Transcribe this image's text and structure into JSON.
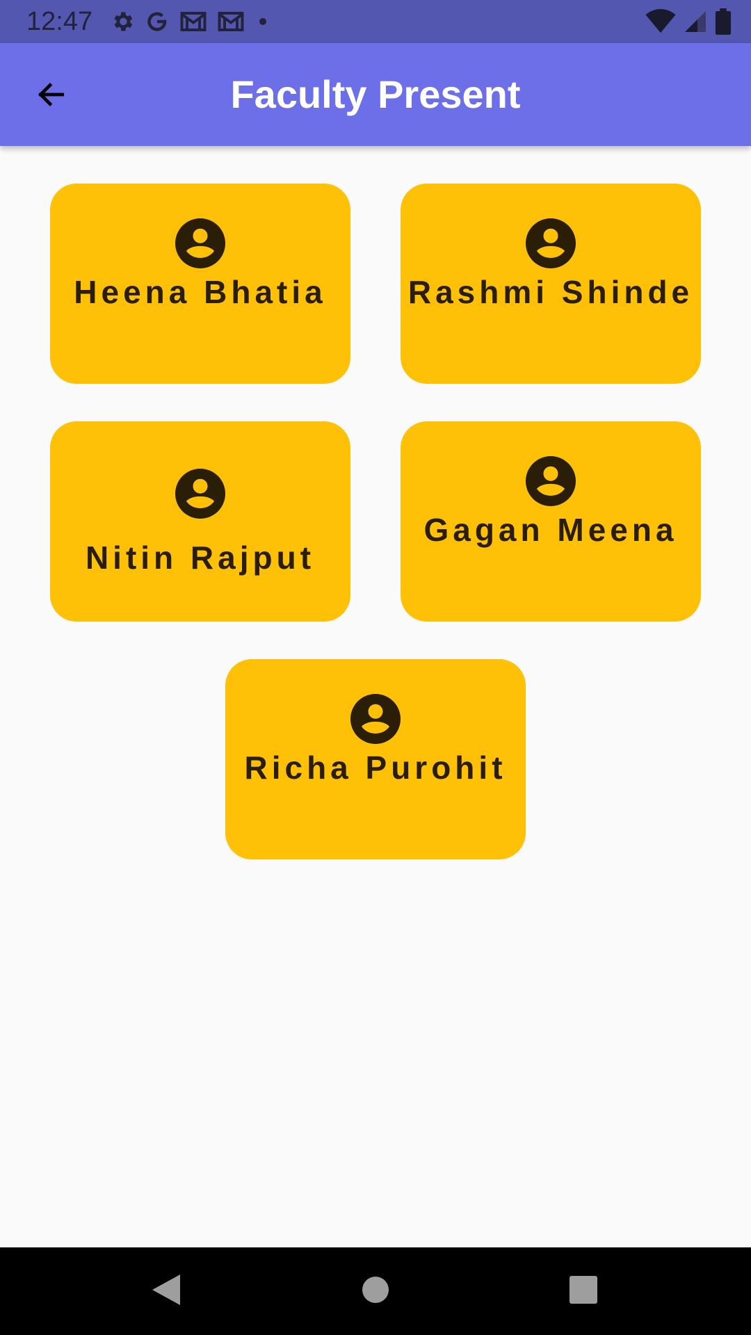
{
  "status_bar": {
    "time": "12:47",
    "icons_left": [
      "gear-icon",
      "google-g-icon",
      "gmail-icon",
      "gmail-icon",
      "dot-icon"
    ],
    "icons_right": [
      "wifi-icon",
      "signal-icon",
      "battery-icon"
    ]
  },
  "app_bar": {
    "title": "Faculty Present",
    "back_icon": "arrow-back-icon",
    "color": "#6c6fe8"
  },
  "faculty": [
    {
      "name": "Heena Bhatia",
      "icon": "account-circle-icon"
    },
    {
      "name": "Rashmi Shinde",
      "icon": "account-circle-icon"
    },
    {
      "name": "Nitin Rajput",
      "icon": "account-circle-icon"
    },
    {
      "name": "Gagan Meena",
      "icon": "account-circle-icon"
    },
    {
      "name": "Richa Purohit",
      "icon": "account-circle-icon"
    }
  ],
  "card_color": "#ffc107",
  "nav_bar": {
    "buttons": [
      "back-triangle-icon",
      "home-circle-icon",
      "recents-square-icon"
    ]
  }
}
